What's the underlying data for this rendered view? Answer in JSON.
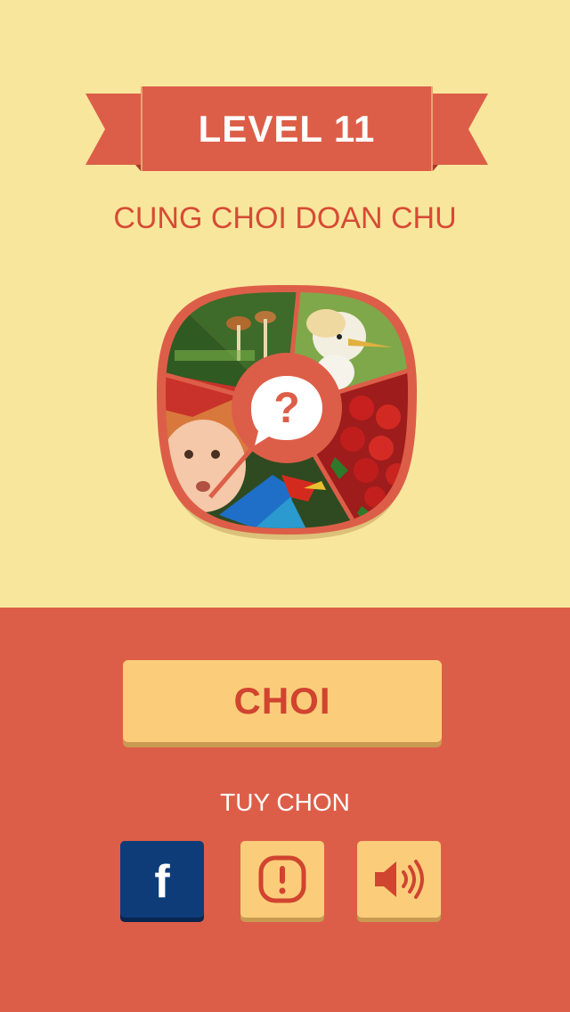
{
  "banner": {
    "level_label": "LEVEL 11"
  },
  "subtitle": "CUNG CHOI DOAN CHU",
  "collage": {
    "center_icon": "question-speech-bubble-icon",
    "tiles": [
      "mushrooms",
      "egret",
      "baby",
      "strawberries",
      "macaw"
    ]
  },
  "play_button": {
    "label": "CHOI"
  },
  "options": {
    "label": "TUY CHON",
    "buttons": [
      {
        "name": "facebook",
        "icon": "facebook-icon",
        "glyph": "f"
      },
      {
        "name": "info",
        "icon": "exclamation-icon"
      },
      {
        "name": "sound",
        "icon": "speaker-icon"
      }
    ]
  },
  "colors": {
    "top_background": "#F9E69D",
    "bottom_background": "#DD5E48",
    "accent_red": "#D64C35",
    "button_fill": "#FBCD7A",
    "facebook_blue": "#0E3C78"
  }
}
